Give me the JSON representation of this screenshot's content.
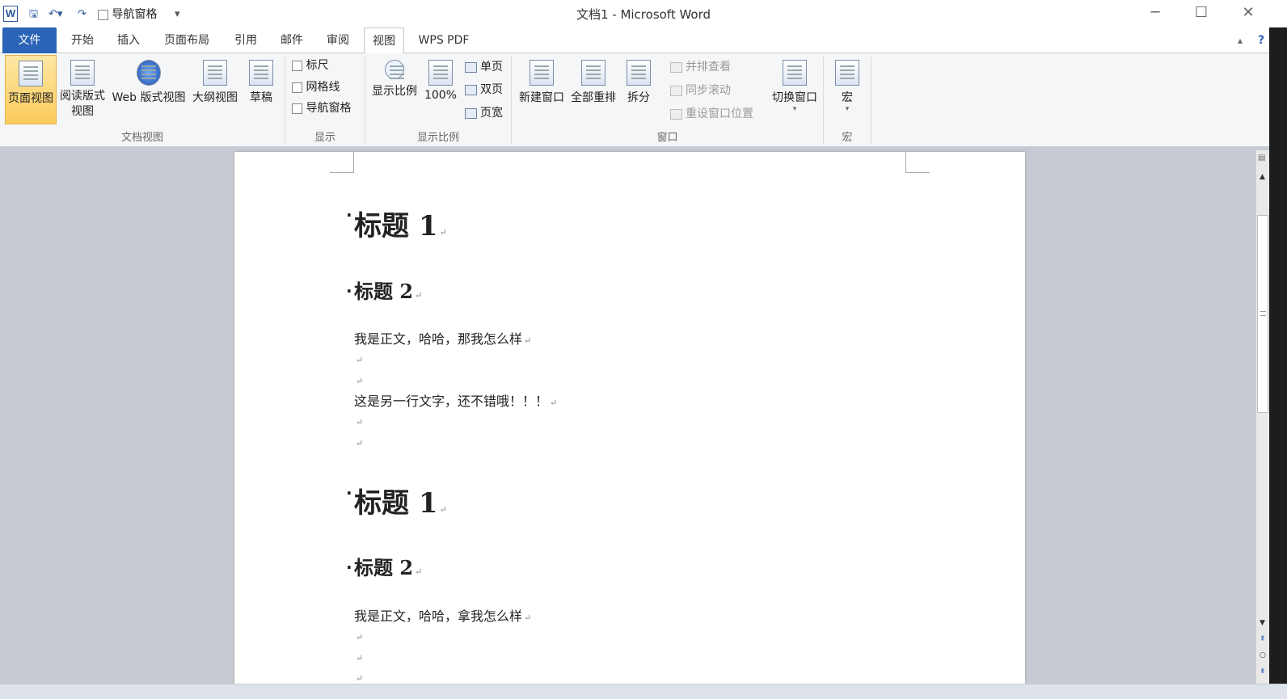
{
  "window": {
    "title": "文档1 - Microsoft Word",
    "app_icon": "W"
  },
  "quick_access": {
    "nav_pane_label": "导航窗格"
  },
  "tabs": [
    "文件",
    "开始",
    "插入",
    "页面布局",
    "引用",
    "邮件",
    "审阅",
    "视图",
    "WPS PDF"
  ],
  "ribbon": {
    "doc_views": {
      "label": "文档视图",
      "page_view": "页面视图",
      "read_view_1": "阅读版式",
      "read_view_2": "视图",
      "web_view": "Web 版式视图",
      "outline": "大纲视图",
      "draft": "草稿"
    },
    "show": {
      "label": "显示",
      "ruler": "标尺",
      "gridlines": "网格线",
      "nav_pane": "导航窗格"
    },
    "zoom": {
      "label": "显示比例",
      "zoom": "显示比例",
      "percent": "100%",
      "one_page": "单页",
      "two_pages": "双页",
      "page_width": "页宽"
    },
    "window": {
      "label": "窗口",
      "new_window": "新建窗口",
      "arrange_all": "全部重排",
      "split": "拆分",
      "side_by_side": "并排查看",
      "sync_scroll": "同步滚动",
      "reset_pos": "重设窗口位置",
      "switch_windows": "切换窗口"
    },
    "macros": {
      "label": "宏",
      "macros": "宏"
    }
  },
  "document": {
    "h1a": "标题 1",
    "h2a": "标题 2",
    "p1": "我是正文，哈哈，那我怎么样",
    "p2": "这是另一行文字，还不错哦！！！",
    "h1b": "标题 1",
    "h2b": "标题 2",
    "p3": "我是正文，哈哈，拿我怎么样"
  },
  "colors": {
    "file_tab": "#2b64b6",
    "selected_button": "#fbcb5c"
  }
}
